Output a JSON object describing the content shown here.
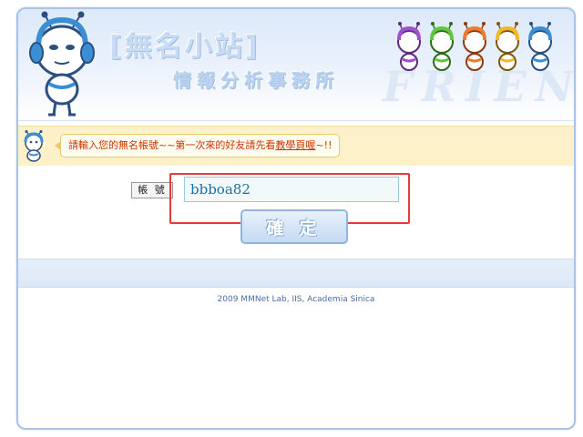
{
  "header": {
    "site_name": "[無名小站]",
    "tagline": "情報分析事務所",
    "ghost_text": "FRIEND"
  },
  "notice": {
    "text_before_link": "請輸入您的無名帳號~~第一次來的好友請先看",
    "link_text": "教學頁喔",
    "text_after_link": "~!!"
  },
  "login_form": {
    "account_label": "帳 號",
    "account_value": "bbboa82",
    "submit_label": "確 定"
  },
  "footer": {
    "copyright": "2009 MMNet Lab, IIS, Academia Sinica"
  },
  "colors": {
    "frame_border": "#a9c3e8",
    "notice_bg": "#fdf1c9",
    "notice_text": "#cc3300",
    "highlight_border": "#e43b3b",
    "footer_text": "#4a6fa8"
  },
  "icons": [
    "mascot-logo-icon",
    "friend-mascots-icon",
    "notice-mascot-icon"
  ]
}
